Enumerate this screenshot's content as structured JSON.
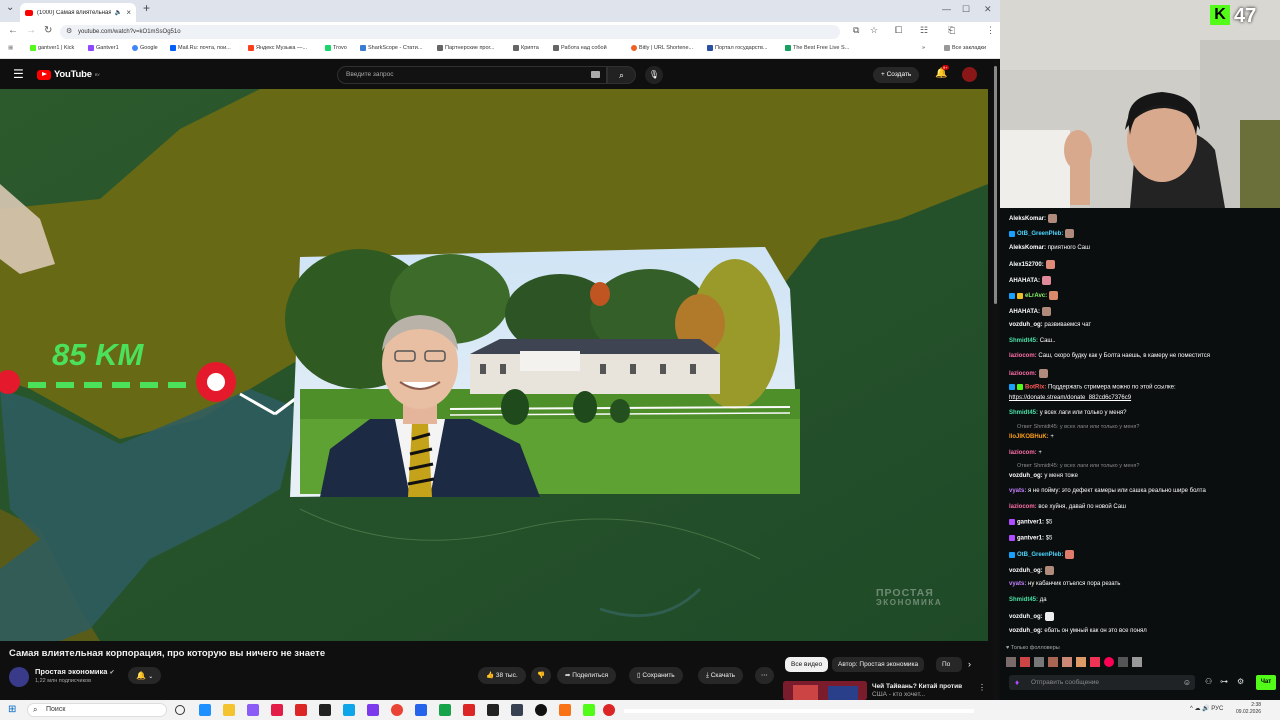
{
  "browser": {
    "tab_title": "(1000) Самая влиятельная...",
    "url": "youtube.com/watch?v=kO1mSsOg51o",
    "bookmarks": [
      "gantver1 | Kick",
      "Gantver1",
      "Google",
      "Mail.Ru: почта, пои...",
      "Яндекс Музыка —...",
      "Trovo",
      "SharkScope - Стати...",
      "Партнерские прог...",
      "Крипта",
      "Работа над собой",
      "Bitly | URL Shortene...",
      "Портал государств...",
      "The Best Free Live S..."
    ],
    "all_bookmarks": "Все закладки"
  },
  "youtube": {
    "logo_text": "YouTube",
    "region": "BY",
    "search_placeholder": "Введите запрос",
    "create_label": "Создать",
    "notif_count": "9+"
  },
  "video": {
    "overlay_distance": "85 KM",
    "watermark_line1": "ПРОСТАЯ",
    "watermark_line2": "ЭКОНОМИКА",
    "title": "Самая влиятельная корпорация, про которую вы ничего не знаете",
    "channel": "Простая экономика",
    "subscribers": "1,22 млн подписчиков",
    "likes": "38 тыс.",
    "share_label": "Поделиться",
    "save_label": "Сохранить",
    "download_label": "Скачать",
    "chips": [
      "Все видео",
      "Автор: Простая экономика",
      "По"
    ],
    "rec_title_1": "Чей Тайвань? Китай против",
    "rec_title_2": "США - кто хочет..."
  },
  "stream": {
    "viewers": "47",
    "followers_only": "Только фолловеры",
    "chat_placeholder": "Отправить сообщение",
    "chat_button": "Чат"
  },
  "chat": [
    {
      "user": "AleksKomar:",
      "text": "",
      "color": "#ffffff"
    },
    {
      "user": "OtB_GreenPleb:",
      "text": "",
      "color": "#4bd6ff"
    },
    {
      "user": "AleksKomar:",
      "text": "приятного Саш",
      "color": "#ffffff"
    },
    {
      "user": "Alex152700:",
      "text": "",
      "color": "#ffffff"
    },
    {
      "user": "АНАНАТА:",
      "text": "",
      "color": "#ffffff"
    },
    {
      "user": "eLrAvc:",
      "text": "",
      "color": "#8df26b"
    },
    {
      "user": "АНАНАТА:",
      "text": "",
      "color": "#ffffff"
    },
    {
      "user": "vozduh_og:",
      "text": "развиваемся чат",
      "color": "#ffffff"
    },
    {
      "user": "Shmidt45:",
      "text": "Саш..",
      "color": "#4be2a6"
    },
    {
      "user": "laziocom:",
      "text": "Саш, скоро будку как у Болта наешь, в камеру не поместится",
      "color": "#ff6ea8"
    },
    {
      "user": "laziocom:",
      "text": "",
      "color": "#ff6ea8"
    },
    {
      "user": "BotRix:",
      "text": "Поддержать стримера можно по этой ссылке:",
      "color": "#ff5a5a"
    },
    {
      "user": "",
      "text": "https://donate.stream/donate_882cd6c7376c9",
      "color": "#ffffff"
    },
    {
      "user": "Shmidt45:",
      "text": "у всех лаги или только у меня?",
      "color": "#4be2a6"
    },
    {
      "user": "lloJIKOBHuK:",
      "text": "+",
      "color": "#ff9f1a"
    },
    {
      "user": "laziocom:",
      "text": "+",
      "color": "#ff6ea8"
    },
    {
      "user": "vozduh_og:",
      "text": "у меня тоже",
      "color": "#ffffff"
    },
    {
      "user": "vyats:",
      "text": "я не пойму: это дефект камеры или сашка реально шире болта",
      "color": "#c481ff"
    },
    {
      "user": "laziocom:",
      "text": "все хуйня, давай по новой Саш",
      "color": "#ff6ea8"
    },
    {
      "user": "gantver1:",
      "text": "$5",
      "color": "#ffffff"
    },
    {
      "user": "gantver1:",
      "text": "$5",
      "color": "#ffffff"
    },
    {
      "user": "OtB_GreenPleb:",
      "text": "",
      "color": "#4bd6ff"
    },
    {
      "user": "vozduh_og:",
      "text": "",
      "color": "#ffffff"
    },
    {
      "user": "vyats:",
      "text": "ну кабанчик отъелся пора резать",
      "color": "#c481ff"
    },
    {
      "user": "Shmidt45:",
      "text": "да",
      "color": "#4be2a6"
    },
    {
      "user": "vozduh_og:",
      "text": "",
      "color": "#ffffff"
    },
    {
      "user": "vozduh_og:",
      "text": "ебать он умный как он это все понял",
      "color": "#ffffff"
    }
  ],
  "replies": [
    "Ответ Shmidt45: у всех лаги или только у меня?",
    "Ответ Shmidt45: у всех лаги или только у меня?"
  ],
  "taskbar": {
    "search_label": "Поиск",
    "lang": "РУС",
    "time": "2:38",
    "date": "09.02.2026"
  },
  "colors": {
    "kick_green": "#53fc18",
    "youtube_red": "#ff0000"
  }
}
